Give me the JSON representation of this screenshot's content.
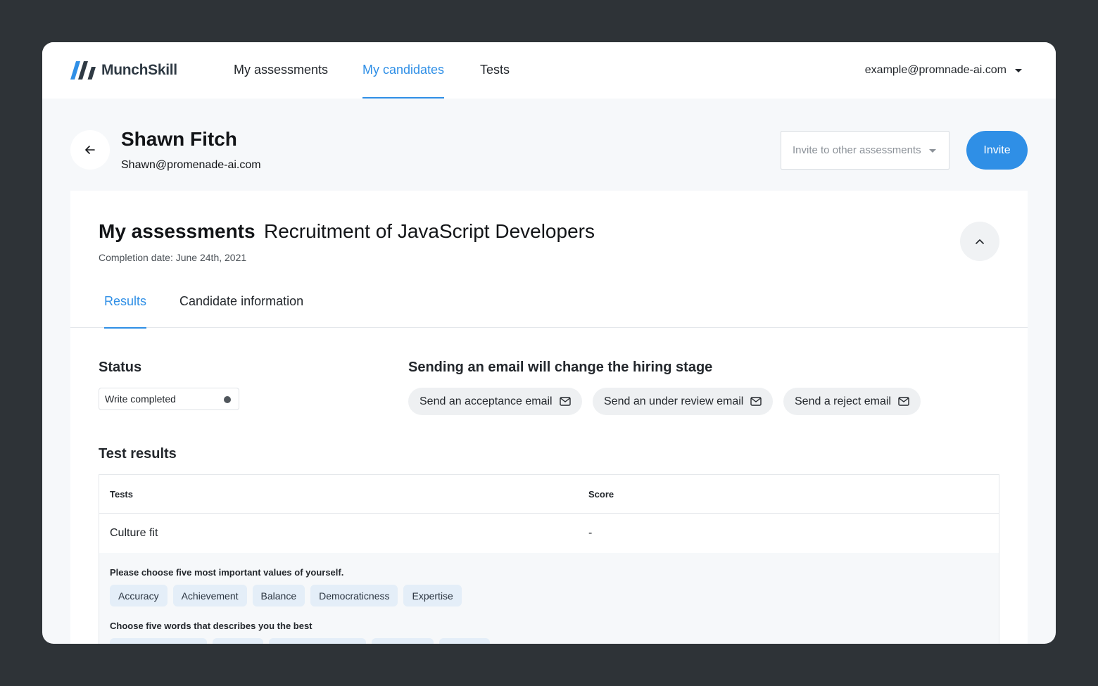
{
  "brand": {
    "name": "MunchSkill"
  },
  "nav": {
    "items": [
      {
        "label": "My assessments"
      },
      {
        "label": "My candidates"
      },
      {
        "label": "Tests"
      }
    ],
    "user_email": "example@promnade-ai.com"
  },
  "candidate": {
    "name": "Shawn Fitch",
    "email": "Shawn@promenade-ai.com",
    "invite_placeholder": "Invite to other assessments",
    "invite_label": "Invite"
  },
  "assessment": {
    "title": "My assessments",
    "name": "Recruitment of JavaScript Developers",
    "completion": "Completion date: June 24th, 2021",
    "tabs": [
      {
        "label": "Results"
      },
      {
        "label": "Candidate information"
      }
    ]
  },
  "status": {
    "title": "Status",
    "value": "Write completed"
  },
  "email_section": {
    "title": "Sending an email will change the hiring stage",
    "buttons": [
      {
        "label": "Send an acceptance email"
      },
      {
        "label": "Send an under review email"
      },
      {
        "label": "Send a reject email"
      }
    ]
  },
  "test_results": {
    "title": "Test results",
    "columns": [
      "Tests",
      "Score"
    ],
    "rows": [
      {
        "test": "Culture fit",
        "score": "-"
      }
    ],
    "questions": [
      {
        "text": "Please choose five most important values of yourself.",
        "answers": [
          "Accuracy",
          "Achievement",
          "Balance",
          "Democraticness",
          "Expertise"
        ]
      },
      {
        "text": "Choose five words that describes you the best",
        "answers": []
      }
    ]
  },
  "colors": {
    "accent": "#2f8fe6",
    "background": "#2e3337",
    "chip": "#e4eef8"
  }
}
